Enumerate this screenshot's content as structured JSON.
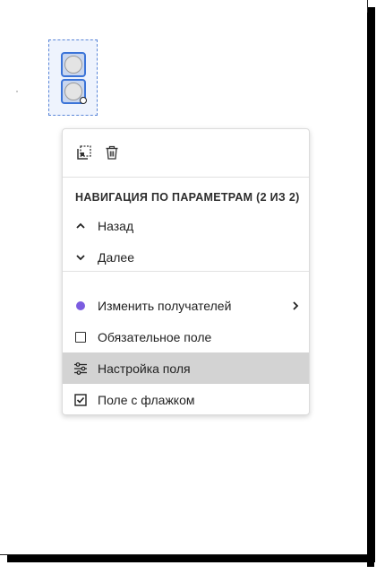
{
  "field": {
    "type": "radio-group",
    "selected": true
  },
  "toolbar": {
    "copy_icon": "duplicate-icon",
    "delete_icon": "trash-icon"
  },
  "menu": {
    "section_heading": "НАВИГАЦИЯ ПО ПАРАМЕТРАМ (2 ИЗ 2)",
    "back_label": "Назад",
    "next_label": "Далее",
    "recipients_label": "Изменить получателей",
    "required_label": "Обязательное поле",
    "setup_label": "Настройка поля",
    "checkbox_label": "Поле с флажком"
  },
  "colors": {
    "accent_blue": "#3b74d8",
    "recipient_purple": "#7b5ce0",
    "highlight": "#d3d3d3"
  }
}
